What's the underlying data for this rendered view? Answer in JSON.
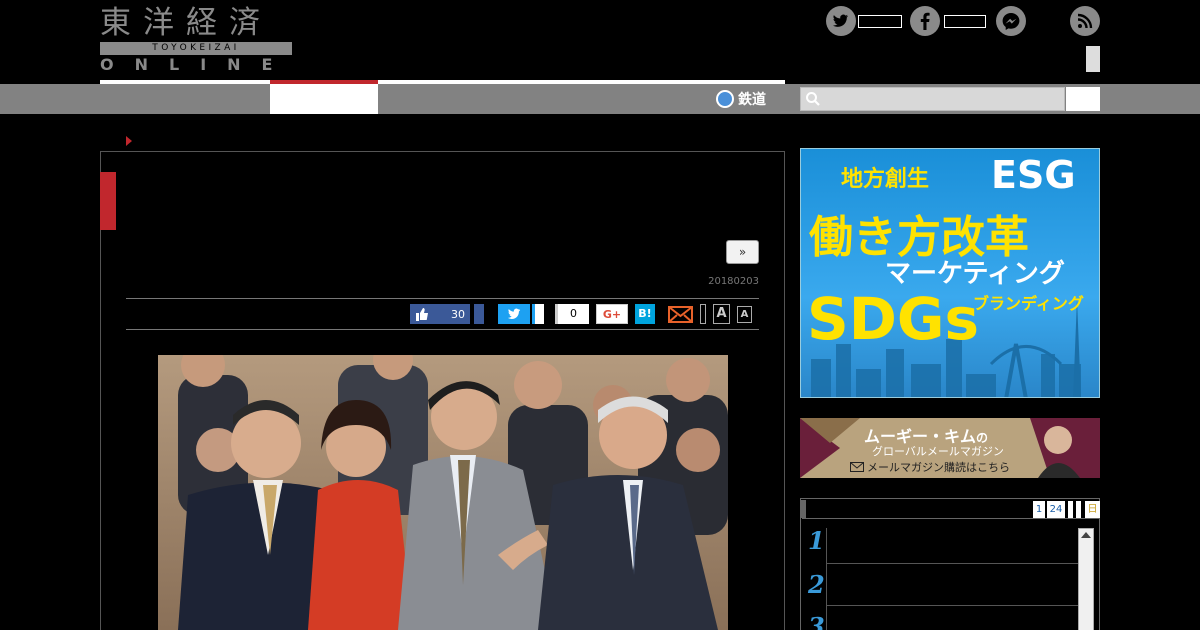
{
  "header": {
    "logo_kanji": "東洋経済",
    "logo_romaji": "TOYOKEIZAI",
    "logo_online": "ONLINE"
  },
  "social": {
    "twitter_icon": "twitter-icon",
    "facebook_icon": "facebook-icon",
    "messenger_icon": "messenger-icon",
    "rss_icon": "rss-icon"
  },
  "nav": {
    "rail_label": "鉄道"
  },
  "article": {
    "date": "20180203",
    "more_label": "»",
    "share": {
      "like_count": "30",
      "pocket_count": "0",
      "google_label": "G+",
      "hatena_label": "B!",
      "font_large": "A",
      "font_small": "A"
    }
  },
  "sidebar": {
    "ad1": {
      "line1": "地方創生",
      "line2": "ESG",
      "line3": "働き方改革",
      "line4": "マーケティング",
      "line5": "SDGs",
      "line6": "ブランディング"
    },
    "ad2": {
      "title": "ムーギー・キム",
      "title_suffix": "の",
      "subtitle": "グローバルメールマガジン",
      "cta": "メールマガジン購読はこちら"
    },
    "ranking": {
      "tabs": [
        "1",
        "24"
      ],
      "tab_last": "日",
      "items": [
        {
          "rank": "1"
        },
        {
          "rank": "2"
        },
        {
          "rank": "3"
        }
      ]
    }
  },
  "colors": {
    "accent_red": "#c1272d",
    "nav_gray": "#828282",
    "twitter_blue": "#1da1f2",
    "facebook_blue": "#3b5998",
    "hatena_blue": "#00a4de",
    "ad_blue": "#1a8fd8",
    "ad_yellow": "#ffe200"
  }
}
